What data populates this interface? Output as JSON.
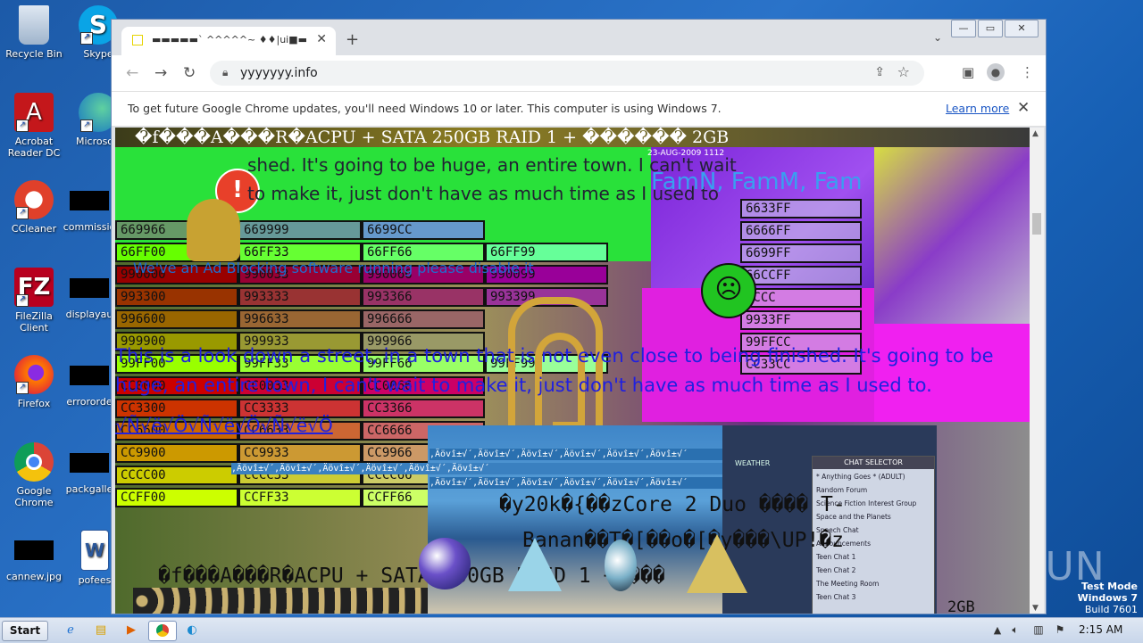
{
  "desktop": {
    "icons": [
      {
        "label": "Recycle Bin",
        "kind": "recycle-bin-icon"
      },
      {
        "label": "Skype",
        "kind": "skype-icon"
      },
      {
        "label": "Acrobat Reader DC",
        "kind": "acrobat-icon"
      },
      {
        "label": "Microsoft",
        "kind": "edge-icon"
      },
      {
        "label": "CCleaner",
        "kind": "ccleaner-icon"
      },
      {
        "label": "commissio",
        "kind": "blank-file-icon"
      },
      {
        "label": "FileZilla Client",
        "kind": "filezilla-icon"
      },
      {
        "label": "displayau",
        "kind": "blank-file-icon"
      },
      {
        "label": "Firefox",
        "kind": "firefox-icon"
      },
      {
        "label": "errororde",
        "kind": "blank-file-icon"
      },
      {
        "label": "Google Chrome",
        "kind": "chrome-icon"
      },
      {
        "label": "packgalle",
        "kind": "blank-file-icon"
      },
      {
        "label": "cannew.jpg",
        "kind": "blank-file-icon"
      },
      {
        "label": "pofees",
        "kind": "word-icon"
      }
    ],
    "watermark": {
      "line1": "Test Mode",
      "line2": "Windows 7",
      "line3": "Build 7601"
    },
    "brand": "ANY.RUN"
  },
  "browser": {
    "tab_title": "▬▬▬▬▬` ^^^^^~ ♦♦|ui■▬",
    "new_tab": "+",
    "url": "yyyyyyy.info",
    "window_controls": {
      "minimize": "—",
      "restore": "▭",
      "close": "✕"
    },
    "infobar": {
      "message": "To get future Google Chrome updates, you'll need Windows 10 or later. This computer is using Windows 7.",
      "link": "Learn more"
    }
  },
  "page": {
    "top_banner": "�f���A���R�ACPU + SATA 250GB RAID 1 + ������ 2GB",
    "green_line1": "shed. It's going to be huge, an entire town. I can't wait",
    "green_line2": "to make it, just don't have as much time as I used to",
    "stamp_text": "23-AUG-2009 1112",
    "notice": "We've an Ad Blocking software running please disable it",
    "famn": "FamN, FamM, Fam",
    "paragraph": "This is a look down a street, in a town that is not even close to being finished. It's going to be huge, an entire town, I can't wait to make it, just don't have as much time as I used to.",
    "mojibake_link": "√Ñ√ë√Ö√Ñ√ë√Ö√Ñ√ë√Ö",
    "hex_cells": [
      [
        "669966",
        "669999",
        "6699CC"
      ],
      [
        "66FF00",
        "66FF33",
        "66FF66",
        "66FF99"
      ],
      [
        "990000",
        "990033",
        "990066",
        "990099"
      ],
      [
        "993300",
        "993333",
        "993366",
        "993399"
      ],
      [
        "996600",
        "996633",
        "996666"
      ],
      [
        "999900",
        "999933",
        "999966"
      ],
      [
        "99FF00",
        "99FF33",
        "99FF66",
        "99FF99"
      ],
      [
        "CC0000",
        "CC0033",
        "CC0066"
      ],
      [
        "CC3300",
        "CC3333",
        "CC3366"
      ],
      [
        "CC6600",
        "CC6633",
        "CC6666"
      ],
      [
        "CC9900",
        "CC9933",
        "CC9966"
      ],
      [
        "CCCC00",
        "CCCC33",
        "CCCC66"
      ],
      [
        "CCFF00",
        "CCFF33",
        "CCFF66"
      ]
    ],
    "right_hex": [
      "6633FF",
      "6666FF",
      "6699FF",
      "66CCFF",
      "CCCC",
      "9933FF",
      "99FFCC",
      "CC33CC"
    ],
    "garbled_row": ",Äövî±√´,Äövî±√´,Äövî±√´,Äövî±√´,Äövî±√´,Äövî±√´",
    "mono_line1": "�y20k�{��zCore 2 Duo ���� T-",
    "mono_line2": "Banan��T�[��o�[�y���\\UP!�z",
    "mono_line3": "�f���A���R�ACPU + SATA 250GB RAID 1 + ���",
    "mono_tail": "2GB",
    "chat_window_title": "CHAT SELECTOR",
    "chat_items": [
      "* Anything Goes * (ADULT)",
      "Random Forum",
      "Science Fiction Interest Group",
      "Space and the Planets",
      "Speech Chat",
      "Announcements",
      "Teen Chat 1",
      "Teen Chat 2",
      "The Meeting Room",
      "Teen Chat 3"
    ],
    "chat_side": "WEATHER"
  },
  "taskbar": {
    "start": "Start",
    "clock": "2:15 AM"
  },
  "colors": {
    "taskbar": "#dfe7f3",
    "desktop": "#1c5aa8",
    "link": "#1a56c4"
  }
}
